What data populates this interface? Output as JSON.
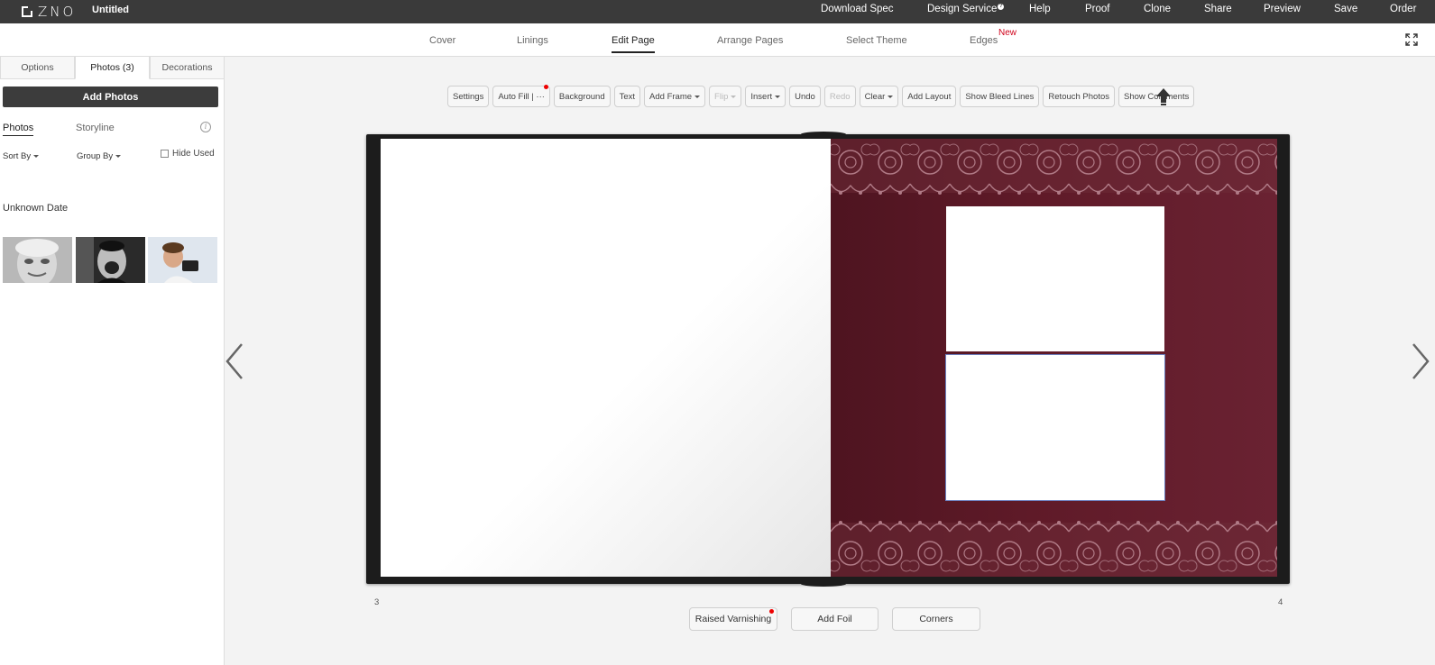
{
  "app": {
    "logo_text": "ZNO",
    "doc_title": "Untitled"
  },
  "topnav": {
    "download_spec": "Download Spec",
    "design_service": "Design Service",
    "design_service_help": "?",
    "help": "Help",
    "proof": "Proof",
    "clone": "Clone",
    "share": "Share",
    "preview": "Preview",
    "save": "Save",
    "order": "Order"
  },
  "main_tabs": {
    "cover": "Cover",
    "linings": "Linings",
    "edit_page": "Edit Page",
    "arrange_pages": "Arrange Pages",
    "select_theme": "Select Theme",
    "edges": "Edges",
    "edges_badge": "New",
    "active": "Edit Page"
  },
  "left_panel": {
    "tabs": {
      "options": "Options",
      "photos": "Photos (3)",
      "decorations": "Decorations"
    },
    "add_photos": "Add Photos",
    "subtabs": {
      "photos": "Photos",
      "storyline": "Storyline"
    },
    "info_glyph": "i",
    "sort_by": "Sort By",
    "group_by": "Group By",
    "hide_used": "Hide Used",
    "hide_used_checked": false,
    "date_group": "Unknown Date",
    "photo_count": 3
  },
  "toolbar": {
    "settings": "Settings",
    "auto_fill": "Auto Fill",
    "auto_fill_more": "| ···",
    "background": "Background",
    "text": "Text",
    "add_frame": "Add Frame",
    "flip": "Flip",
    "insert": "Insert",
    "undo": "Undo",
    "redo": "Redo",
    "clear": "Clear",
    "add_layout": "Add Layout",
    "show_bleed_lines": "Show Bleed Lines",
    "retouch_photos": "Retouch Photos",
    "show_comments": "Show Comments"
  },
  "spread": {
    "left_page_number": "3",
    "right_page_number": "4",
    "right_page_background": "#5a1826"
  },
  "bottom_buttons": {
    "raised_varnishing": "Raised Varnishing",
    "add_foil": "Add Foil",
    "corners": "Corners"
  },
  "colors": {
    "topbar": "#3a3a3a",
    "accent_red": "#d0021b",
    "page_burgundy": "#5a1826"
  }
}
